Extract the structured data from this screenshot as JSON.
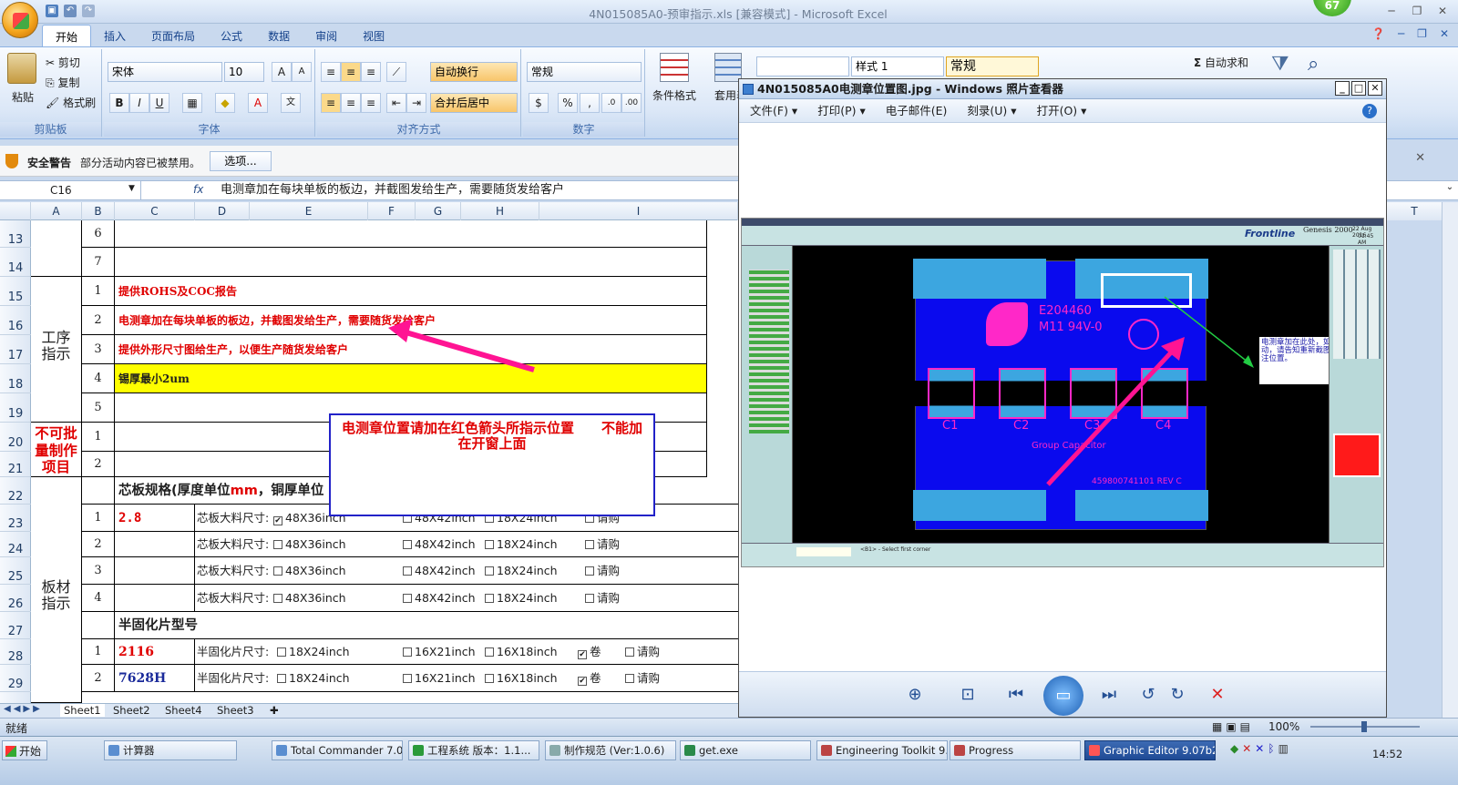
{
  "window": {
    "title": "4N015085A0-预审指示.xls  [兼容模式] - Microsoft Excel",
    "badge": "67"
  },
  "ribbon": {
    "tabs": [
      "开始",
      "插入",
      "页面布局",
      "公式",
      "数据",
      "审阅",
      "视图"
    ],
    "clipboard": {
      "paste": "粘贴",
      "cut": "剪切",
      "copy": "复制",
      "format_painter": "格式刷",
      "label": "剪贴板"
    },
    "font": {
      "name": "宋体",
      "size": "10",
      "label": "字体"
    },
    "alignment": {
      "wrap": "自动换行",
      "merge": "合并后居中",
      "label": "对齐方式"
    },
    "number": {
      "format": "常规",
      "label": "数字"
    },
    "styles": {
      "conditional": "条件格式",
      "table": "套用表格格",
      "style_name": "样式 1",
      "style_value": "常规"
    },
    "editing": {
      "autosum": "自动求和"
    }
  },
  "security": {
    "title": "安全警告",
    "message": "部分活动内容已被禁用。",
    "options_button": "选项..."
  },
  "formula_bar": {
    "name_box": "C16",
    "fx": "fx",
    "content": "电测章加在每块单板的板边，并截图发给生产，需要随货发给客户"
  },
  "columns": [
    "A",
    "B",
    "C",
    "D",
    "E",
    "F",
    "G",
    "H",
    "I"
  ],
  "extra_column": "T",
  "rows": [
    "13",
    "14",
    "15",
    "16",
    "17",
    "18",
    "19",
    "20",
    "21",
    "22",
    "23",
    "24",
    "25",
    "26",
    "27",
    "28",
    "29"
  ],
  "sheet": {
    "group_process": "工序\n指示",
    "group_no_batch": "不可批\n量制作\n项目",
    "group_board": "板材\n指示",
    "nums": [
      "6",
      "7",
      "1",
      "2",
      "3",
      "4",
      "5",
      "1",
      "2"
    ],
    "process_items": [
      "提供ROHS及COC报告",
      "电测章加在每块单板的板边，并截图发给生产，需要随货发给客户",
      "提供外形尺寸图给生产，以便生产随货发给客户",
      "锡厚最小2um"
    ],
    "core_header": "芯板规格(厚度单位mm，铜厚单位",
    "core_header_mm": "mm",
    "core_rows": [
      {
        "n": "1",
        "val": "2.8",
        "label": "芯板大料尺寸:",
        "o1": "48X36inch",
        "o2": "48X42inch",
        "o3": "18X24inch",
        "o4": "请购",
        "checked": true
      },
      {
        "n": "2",
        "val": "",
        "label": "芯板大料尺寸:",
        "o1": "48X36inch",
        "o2": "48X42inch",
        "o3": "18X24inch",
        "o4": "请购",
        "checked": false
      },
      {
        "n": "3",
        "val": "",
        "label": "芯板大料尺寸:",
        "o1": "48X36inch",
        "o2": "48X42inch",
        "o3": "18X24inch",
        "o4": "请购",
        "checked": false
      },
      {
        "n": "4",
        "val": "",
        "label": "芯板大料尺寸:",
        "o1": "48X36inch",
        "o2": "48X42inch",
        "o3": "18X24inch",
        "o4": "请购",
        "checked": false
      }
    ],
    "prepreg_header": "半固化片型号",
    "prepreg_rows": [
      {
        "n": "1",
        "val": "2116",
        "label": "半固化片尺寸:",
        "o1": "18X24inch",
        "o2": "16X21inch",
        "o3": "16X18inch",
        "o4": "卷",
        "o5": "请购"
      },
      {
        "n": "2",
        "val": "7628H",
        "label": "半固化片尺寸:",
        "o1": "18X24inch",
        "o2": "16X21inch",
        "o3": "16X18inch",
        "o4": "卷",
        "o5": "请购"
      }
    ],
    "note": "电测章位置请加在红色箭头所指示位置　　不能加在开窗上面"
  },
  "sheet_tabs": [
    "Sheet1",
    "Sheet2",
    "Sheet4",
    "Sheet3"
  ],
  "status": {
    "ready": "就绪",
    "zoom": "100%"
  },
  "viewer": {
    "title": "4N015085A0电测章位置图.jpg - Windows 照片查看器",
    "menu": [
      "文件(F)",
      "打印(P)",
      "电子邮件(E)",
      "刻录(U)",
      "打开(O)"
    ],
    "image": {
      "brand": "Frontline",
      "product": "Genesis 2000",
      "date": "22 Aug 2016",
      "time": "01:45 AM",
      "marking_code": "E204460",
      "marking_grade": "M11 94V-0",
      "pads": [
        "C1",
        "C2",
        "C3",
        "C4"
      ],
      "group_label": "Group Capacitor",
      "serial": "459800741101 REV C",
      "annotation": "电测章加在此处，如需改动，请告知重新截图，标注位置。",
      "statusline": "<B1> - Select first corner"
    }
  },
  "taskbar": {
    "start": "开始",
    "tasks": [
      "计算器",
      "Total Commander 7.0 ...",
      "工程系统  版本：1.1...",
      "制作规范 (Ver:1.0.6)",
      "get.exe",
      "Engineering Toolkit 9.0...",
      "Progress",
      "Graphic Editor 9.07b2 ..."
    ],
    "clock": "14:52"
  }
}
